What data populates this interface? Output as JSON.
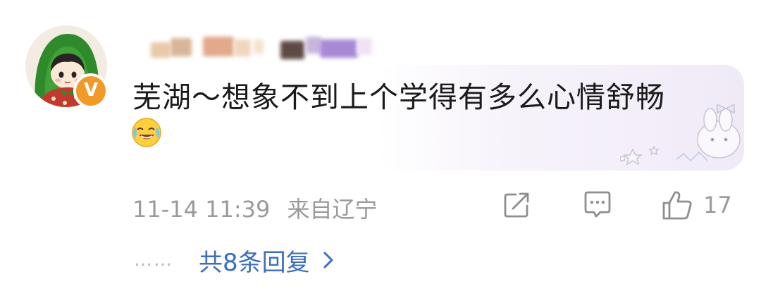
{
  "comment": {
    "username": "",
    "text": "芜湖～想象不到上个学得有多么心情舒畅",
    "emoji_icon": "laughing-tears-emoji",
    "time": "11-14 11:39",
    "location": "来自辽宁",
    "badge": "V",
    "like_count": "17"
  },
  "actions": {
    "share_icon": "share-icon",
    "reply_icon": "comment-icon",
    "like_icon": "thumbs-up-icon"
  },
  "replies": {
    "dots": "……",
    "label": "共8条回复",
    "chevron_icon": "chevron-right-icon"
  },
  "colors": {
    "text": "#1a1a1a",
    "meta": "#9a9a9a",
    "link": "#3b6ec0",
    "badge": "#f29a28"
  }
}
